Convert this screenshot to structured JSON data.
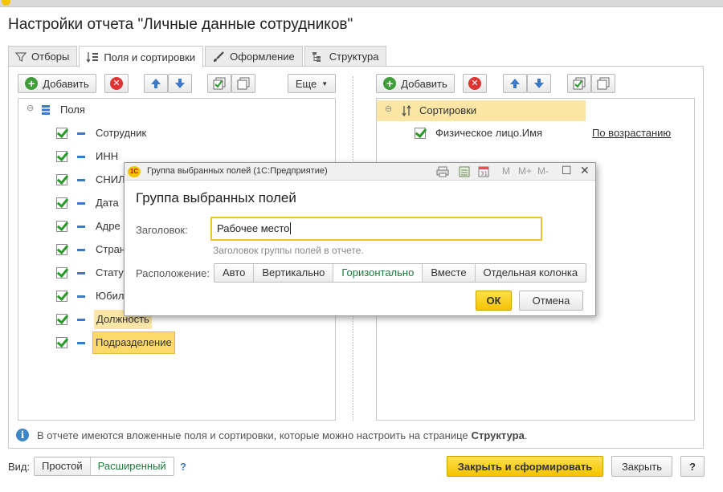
{
  "page": {
    "title": "Настройки отчета \"Личные данные сотрудников\""
  },
  "tabs": [
    {
      "label": "Отборы",
      "icon": "filter-icon"
    },
    {
      "label": "Поля и сортировки",
      "icon": "fields-sort-icon"
    },
    {
      "label": "Оформление",
      "icon": "brush-icon"
    },
    {
      "label": "Структура",
      "icon": "structure-icon"
    }
  ],
  "left_panel": {
    "add_label": "Добавить",
    "more_label": "Еще",
    "root_label": "Поля",
    "items": [
      {
        "label": "Сотрудник",
        "checked": true
      },
      {
        "label": "ИНН",
        "checked": true
      },
      {
        "label": "СНИЛ",
        "checked": true
      },
      {
        "label": "Дата",
        "checked": true
      },
      {
        "label": "Адре",
        "checked": true
      },
      {
        "label": "Стран",
        "checked": true
      },
      {
        "label": "Стату",
        "checked": true
      },
      {
        "label": "Юбил",
        "checked": true
      },
      {
        "label": "Должность",
        "checked": true
      },
      {
        "label": "Подразделение",
        "checked": true
      }
    ]
  },
  "right_panel": {
    "add_label": "Добавить",
    "root_label": "Сортировки",
    "items": [
      {
        "label": "Физическое лицо.Имя",
        "order": "По возрастанию",
        "checked": true
      }
    ]
  },
  "info": {
    "text": "В отчете имеются вложенные поля и сортировки, которые можно настроить на странице",
    "link": "Структура",
    "suffix": "."
  },
  "footer": {
    "view_label": "Вид:",
    "simple": "Простой",
    "extended": "Расширенный",
    "help": "?",
    "close_build": "Закрыть и сформировать",
    "close": "Закрыть",
    "help_button": "?"
  },
  "dialog": {
    "caption": "Группа выбранных полей  (1С:Предприятие)",
    "title": "Группа выбранных полей",
    "header_label": "Заголовок:",
    "header_value": "Рабочее место",
    "header_hint": "Заголовок группы полей в отчете.",
    "layout_label": "Расположение:",
    "layout_options": [
      "Авто",
      "Вертикально",
      "Горизонтально",
      "Вместе",
      "Отдельная колонка"
    ],
    "layout_selected": "Горизонтально",
    "ok": "ОК",
    "cancel": "Отмена",
    "toolbar": {
      "m": "M",
      "m_plus": "M+",
      "m_minus": "M-"
    }
  },
  "colors": {
    "accent_yellow": "#f4c300",
    "highlight": "#fbe6a6",
    "green": "#2a9a2a",
    "blue": "#3c79c8"
  }
}
